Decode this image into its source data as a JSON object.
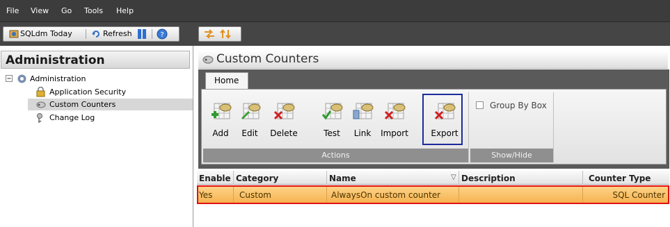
{
  "menu": {
    "items": [
      "File",
      "View",
      "Go",
      "Tools",
      "Help"
    ]
  },
  "toolbar": {
    "today_label": "SQLdm Today",
    "refresh_label": "Refresh"
  },
  "left_panel": {
    "title": "Administration",
    "tree": {
      "root": "Administration",
      "children": [
        "Application Security",
        "Custom Counters",
        "Change Log"
      ]
    }
  },
  "content": {
    "title": "Custom Counters",
    "ribbon": {
      "tab": "Home",
      "actions_group": "Actions",
      "buttons": [
        "Add",
        "Edit",
        "Delete",
        "Test",
        "Link",
        "Import",
        "Export"
      ],
      "showhide_group": "Show/Hide",
      "group_by_box": "Group By Box"
    },
    "grid": {
      "headers": [
        "Enable",
        "Category",
        "Name",
        "Description",
        "Counter Type"
      ],
      "rows": [
        [
          "Yes",
          "Custom",
          "AlwaysOn custom counter",
          "",
          "SQL Counter"
        ]
      ]
    }
  },
  "colors": {
    "selected_row": "#f6b24e",
    "highlight_box_red": "#e01010",
    "highlight_box_blue": "#1c2a9c"
  },
  "icons": [
    "sqldm-today-icon",
    "refresh-icon",
    "pause-icon",
    "help-icon",
    "navigate-icon",
    "gear-icon",
    "security-lock-icon",
    "counter-icon",
    "change-log-icon"
  ]
}
